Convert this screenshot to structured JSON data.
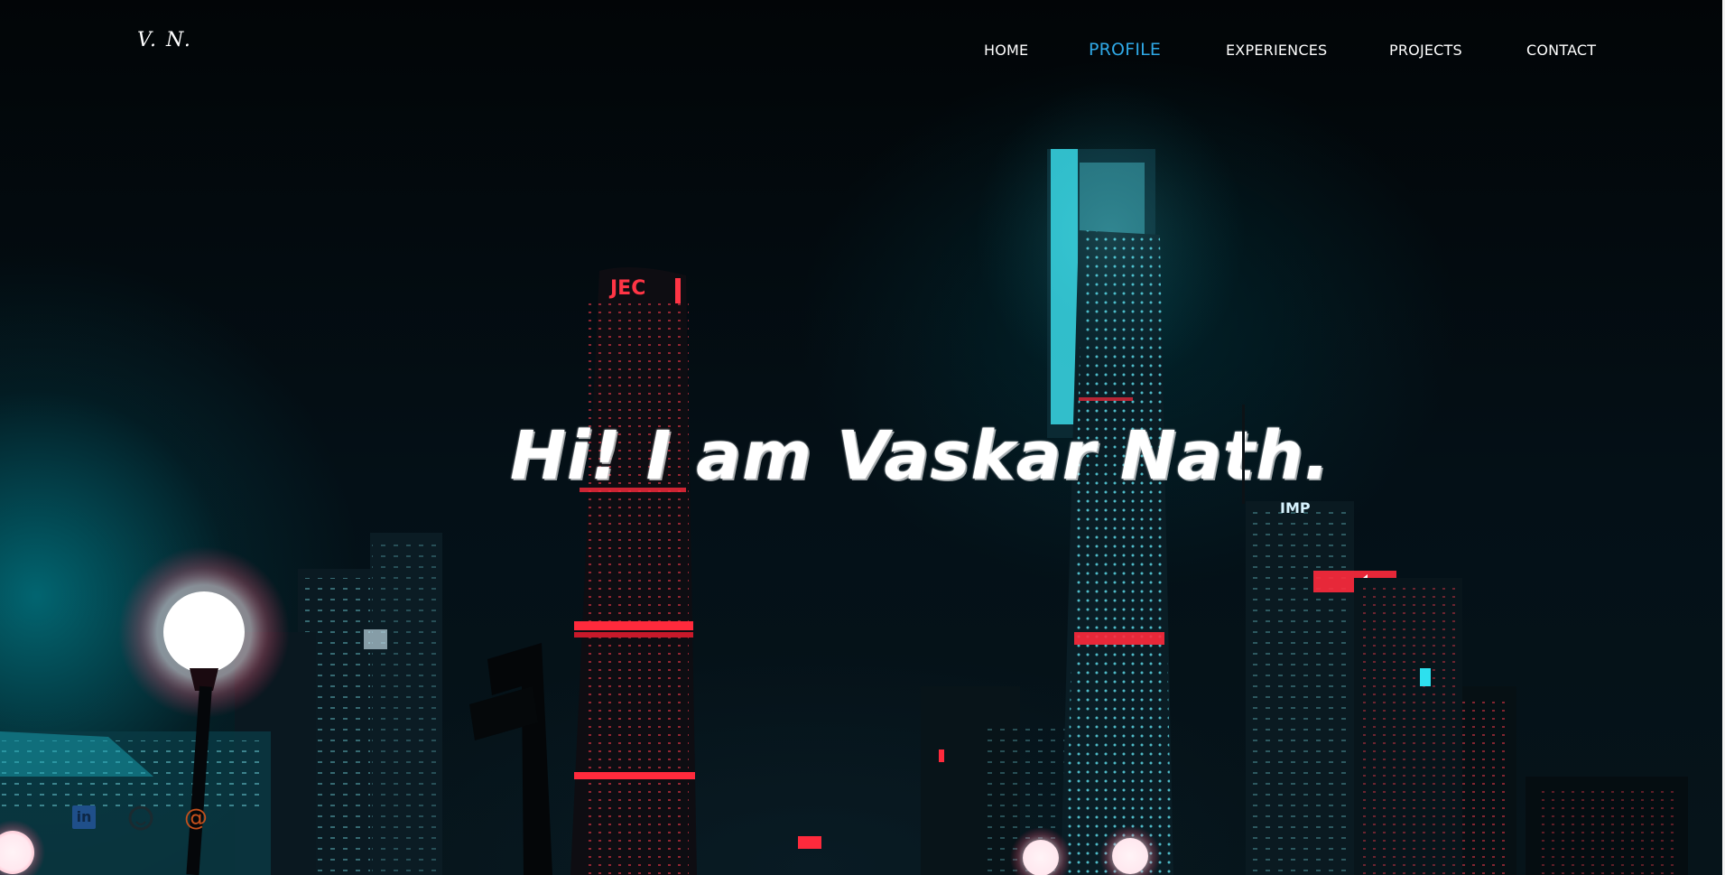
{
  "logo": {
    "text": "V. N."
  },
  "nav": {
    "items": [
      {
        "label": "HOME"
      },
      {
        "label": "PROFILE",
        "active": true
      },
      {
        "label": "EXPERIENCES"
      },
      {
        "label": "PROJECTS"
      },
      {
        "label": "CONTACT"
      }
    ]
  },
  "hero": {
    "headline": "Hi! I am Vaskar Nath."
  },
  "social": [
    {
      "icon": "linkedin-icon",
      "glyph": "in"
    },
    {
      "icon": "github-icon"
    },
    {
      "icon": "email-icon",
      "glyph": "@"
    }
  ],
  "colors": {
    "accent": "#2fa8e6",
    "neon_cyan": "#36e6f0",
    "neon_red": "#ff2a3c",
    "background": "#02080b"
  }
}
